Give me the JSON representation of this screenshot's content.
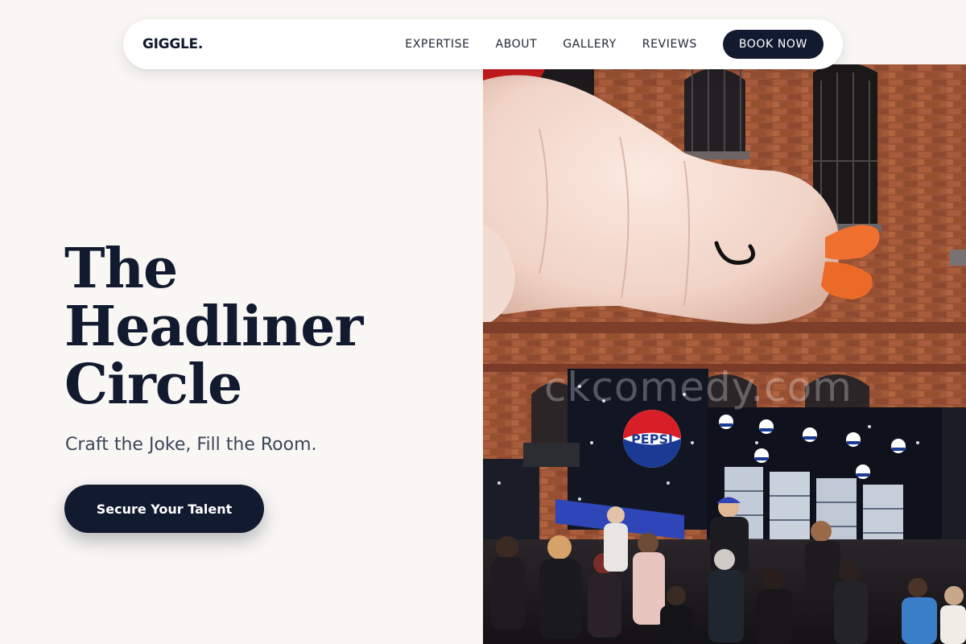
{
  "nav": {
    "logo": "GIGGLE.",
    "links": [
      "EXPERTISE",
      "ABOUT",
      "GALLERY",
      "REVIEWS"
    ],
    "book_label": "BOOK NOW"
  },
  "hero": {
    "title_lines": [
      "The",
      "Headliner",
      "Circle"
    ],
    "subtitle": "Craft the Joke, Fill the Room.",
    "cta_label": "Secure Your Talent"
  },
  "image": {
    "watermark": "ckcomedy.com",
    "brand_sign": "PEPSI"
  },
  "colors": {
    "background": "#f9f7f4",
    "primary": "#111a2e",
    "subtitle": "#3c4558",
    "inflatable_beak": "#f07030"
  }
}
